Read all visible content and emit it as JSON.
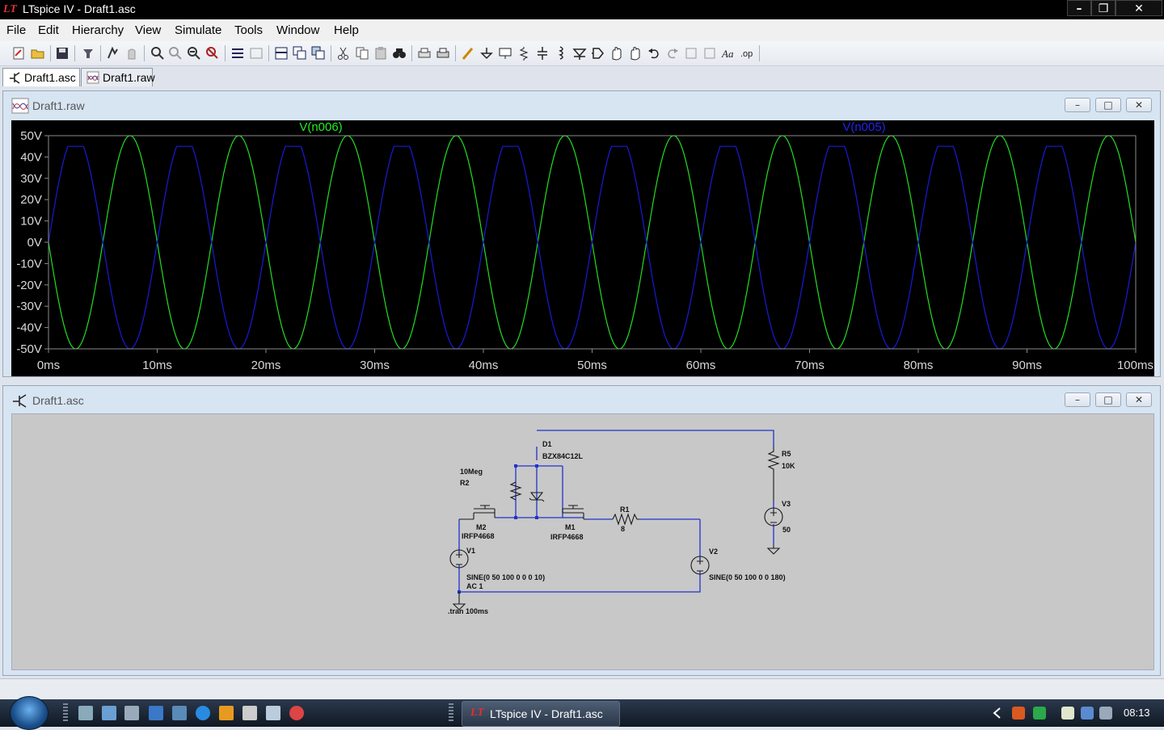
{
  "window": {
    "title": "LTspice IV - Draft1.asc",
    "controls": [
      "minimize",
      "restore",
      "close"
    ]
  },
  "menu": [
    "File",
    "Edit",
    "Hierarchy",
    "View",
    "Simulate",
    "Tools",
    "Window",
    "Help"
  ],
  "toolbar": {
    "icons": [
      "new-schematic-icon",
      "open-icon",
      "save-icon",
      "control-panel-icon",
      "run-icon",
      "halt-icon",
      "zoom-in-icon",
      "zoom-full-icon",
      "zoom-out-icon",
      "autoscale-icon",
      "tile-horizontal-icon",
      "tile-vertical-icon",
      "cascade-icon",
      "close-all-icon",
      "split-icon",
      "cut-icon",
      "copy-icon",
      "paste-icon",
      "find-icon",
      "print-setup-icon",
      "print-icon",
      "draw-wire-icon",
      "ground-icon",
      "label-net-icon",
      "resistor-icon",
      "capacitor-icon",
      "inductor-icon",
      "diode-icon",
      "component-icon",
      "move-icon",
      "drag-icon",
      "undo-icon",
      "redo-icon",
      "rotate-icon",
      "mirror-icon",
      "text-icon",
      "spice-directive-icon"
    ]
  },
  "tabs": [
    {
      "label": "Draft1.asc",
      "active": true
    },
    {
      "label": "Draft1.raw",
      "active": false
    }
  ],
  "waveform_window": {
    "title": "Draft1.raw",
    "traces": [
      {
        "name": "V(n006)",
        "color": "#00e000"
      },
      {
        "name": "V(n005)",
        "color": "#0000e0"
      }
    ]
  },
  "chart_data": {
    "type": "line",
    "xlabel": "",
    "ylabel": "",
    "xlim": [
      0,
      100
    ],
    "ylim": [
      -50,
      50
    ],
    "x_ticks": [
      "0ms",
      "10ms",
      "20ms",
      "30ms",
      "40ms",
      "50ms",
      "60ms",
      "70ms",
      "80ms",
      "90ms",
      "100ms"
    ],
    "y_ticks": [
      "50V",
      "40V",
      "30V",
      "20V",
      "10V",
      "0V",
      "-10V",
      "-20V",
      "-30V",
      "-40V",
      "-50V"
    ],
    "grid": false,
    "series": [
      {
        "name": "V(n006)",
        "color": "#22dd22",
        "function": "sine",
        "amplitude": 50,
        "frequency_hz": 100,
        "phase_deg": 180,
        "clip": null
      },
      {
        "name": "V(n005)",
        "color": "#1a1ad8",
        "function": "sine",
        "amplitude": 50,
        "frequency_hz": 100,
        "phase_deg": 0,
        "clip": 45
      }
    ]
  },
  "schematic_window": {
    "title": "Draft1.asc",
    "labels": {
      "d1": "D1",
      "d1_model": "BZX84C12L",
      "r2_value": "10Meg",
      "r2": "R2",
      "m2": "M2",
      "m2_model": "IRFP4668",
      "m1": "M1",
      "m1_model": "IRFP4668",
      "r1": "R1",
      "r1_value": "8",
      "r5": "R5",
      "r5_value": "10K",
      "v3": "V3",
      "v3_value": "50",
      "v1": "V1",
      "v1_value": "SINE(0 50 100 0 0 0 10)",
      "v1_ac": "AC 1",
      "v2": "V2",
      "v2_value": "SINE(0 50 100 0 0 180)",
      "directive": ".tran 100ms"
    }
  },
  "taskbar": {
    "task_label": "LTspice IV - Draft1.asc",
    "clock": "08:13"
  }
}
